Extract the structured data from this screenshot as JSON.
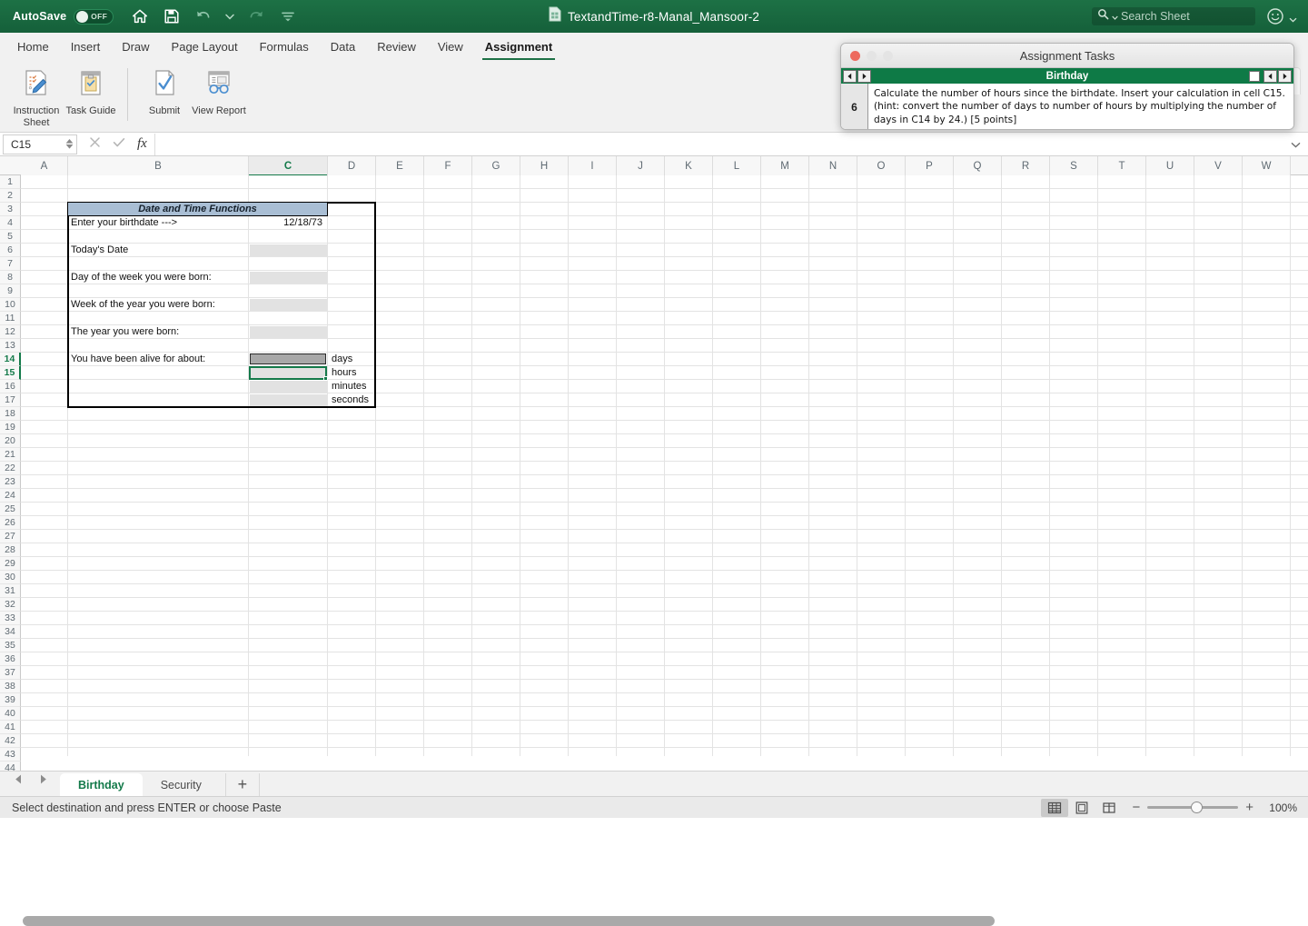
{
  "titlebar": {
    "autosave_label": "AutoSave",
    "autosave_state": "OFF",
    "document_title": "TextandTime-r8-Manal_Mansoor-2",
    "search_placeholder": "Search Sheet",
    "icons": [
      "home-icon",
      "save-icon",
      "undo-icon",
      "undo-dropdown-icon",
      "redo-icon",
      "customize-toolbar-icon"
    ],
    "accent_green": "#15603a"
  },
  "ribbon": {
    "tabs": [
      {
        "label": "Home",
        "active": false
      },
      {
        "label": "Insert",
        "active": false
      },
      {
        "label": "Draw",
        "active": false
      },
      {
        "label": "Page Layout",
        "active": false
      },
      {
        "label": "Formulas",
        "active": false
      },
      {
        "label": "Data",
        "active": false
      },
      {
        "label": "Review",
        "active": false
      },
      {
        "label": "View",
        "active": false
      },
      {
        "label": "Assignment",
        "active": true
      }
    ],
    "buttons": [
      {
        "label": "Instruction Sheet",
        "icon": "instruction-sheet-icon"
      },
      {
        "label": "Task Guide",
        "icon": "task-guide-icon"
      },
      {
        "label": "Submit",
        "icon": "submit-icon"
      },
      {
        "label": "View Report",
        "icon": "view-report-icon"
      }
    ]
  },
  "formula_bar": {
    "name_box": "C15",
    "formula_value": "",
    "cancel_icon": "cancel-icon",
    "enter_icon": "enter-icon",
    "fx_label": "fx"
  },
  "grid": {
    "columns": [
      "A",
      "B",
      "C",
      "D",
      "E",
      "F",
      "G",
      "H",
      "I",
      "J",
      "K",
      "L",
      "M",
      "N",
      "O",
      "P",
      "Q",
      "R",
      "S",
      "T",
      "U",
      "V",
      "W"
    ],
    "selected_column": "C",
    "selected_rows": [
      14,
      15
    ],
    "first_row": 1,
    "last_row": 44,
    "table_title": "Date and Time Functions",
    "labels": [
      {
        "row": 4,
        "text": "Enter your birthdate --->"
      },
      {
        "row": 6,
        "text": "Today's Date"
      },
      {
        "row": 8,
        "text": "Day of the week you were born:"
      },
      {
        "row": 10,
        "text": "Week of the year you were born:"
      },
      {
        "row": 12,
        "text": "The year you were born:"
      },
      {
        "row": 14,
        "text": "You have been alive for about:"
      }
    ],
    "values_c": [
      {
        "row": 4,
        "text": "12/18/73"
      }
    ],
    "units_d": [
      {
        "row": 14,
        "text": "days"
      },
      {
        "row": 15,
        "text": "hours"
      },
      {
        "row": 16,
        "text": "minutes"
      },
      {
        "row": 17,
        "text": "seconds"
      }
    ],
    "shaded_rows_c": [
      6,
      8,
      10,
      12,
      16,
      17
    ],
    "copy_source_cell": "C14",
    "active_cell": "C15",
    "title_fill": "#a9bed4",
    "shade_fill": "#e2e2e2",
    "copy_fill": "#a8a8a8",
    "selection_color": "#147a4a"
  },
  "task_window": {
    "title": "Assignment Tasks",
    "sheet_name": "Birthday",
    "task_number": "6",
    "task_text": "Calculate the number of hours since the birthdate. Insert your calculation in cell C15. (hint: convert the number of days to number of hours by multiplying the number of days in C14 by 24.) [5 points]",
    "traffic_lights": [
      "close-red",
      "minimize-gray",
      "zoom-gray"
    ],
    "bar_color": "#0e7a46"
  },
  "sheet_tabs": {
    "prev_icon": "prev-sheet-icon",
    "next_icon": "next-sheet-icon",
    "tabs": [
      {
        "label": "Birthday",
        "active": true
      },
      {
        "label": "Security",
        "active": false
      }
    ],
    "add_label": "+"
  },
  "status_bar": {
    "message": "Select destination and press ENTER or choose Paste",
    "views": [
      {
        "name": "normal-view-icon",
        "active": true
      },
      {
        "name": "page-layout-view-icon",
        "active": false
      },
      {
        "name": "page-break-view-icon",
        "active": false
      }
    ],
    "zoom_out": "−",
    "zoom_in": "+",
    "zoom_level": "100%"
  }
}
